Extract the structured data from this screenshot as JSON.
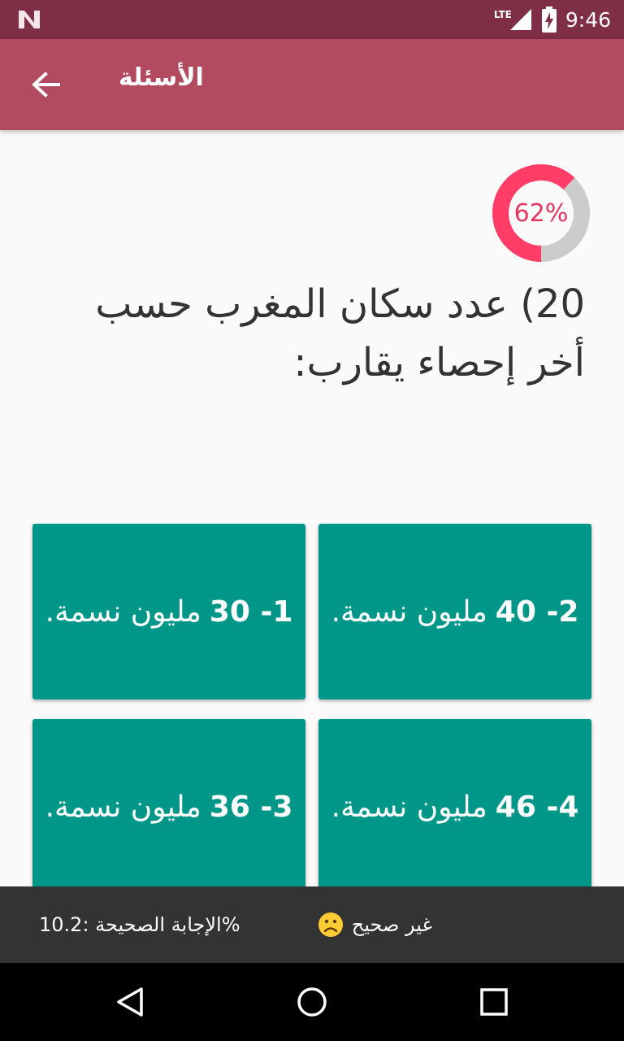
{
  "status_bar": {
    "network_label": "LTE",
    "time": "9:46",
    "icons": [
      "n-logo-icon",
      "signal-icon",
      "battery-charging-icon"
    ]
  },
  "app_bar": {
    "title": "الأسئلة",
    "back_icon": "arrow-back-icon"
  },
  "progress": {
    "label": "62%",
    "value": 0.62,
    "track_color": "#cccccc",
    "fill_color": "#ff3d67"
  },
  "question": {
    "text": "20) عدد سكان المغرب حسب أخر إحصاء يقارب:"
  },
  "answers": [
    {
      "number": "1- 30",
      "text": "مليون نسمة."
    },
    {
      "number": "2- 40",
      "text": "مليون نسمة."
    },
    {
      "number": "3- 36",
      "text": "مليون نسمة."
    },
    {
      "number": "4- 46",
      "text": "مليون نسمة."
    }
  ],
  "feedback": {
    "status": "غير صحيح",
    "status_icon": "sad-face-icon",
    "correct_answer": "الإجابة الصحيحة :10.2%"
  },
  "colors": {
    "status_bar": "#7f2f45",
    "app_bar": "#b24a60",
    "answer_button": "#009688",
    "snackbar": "#333333"
  }
}
